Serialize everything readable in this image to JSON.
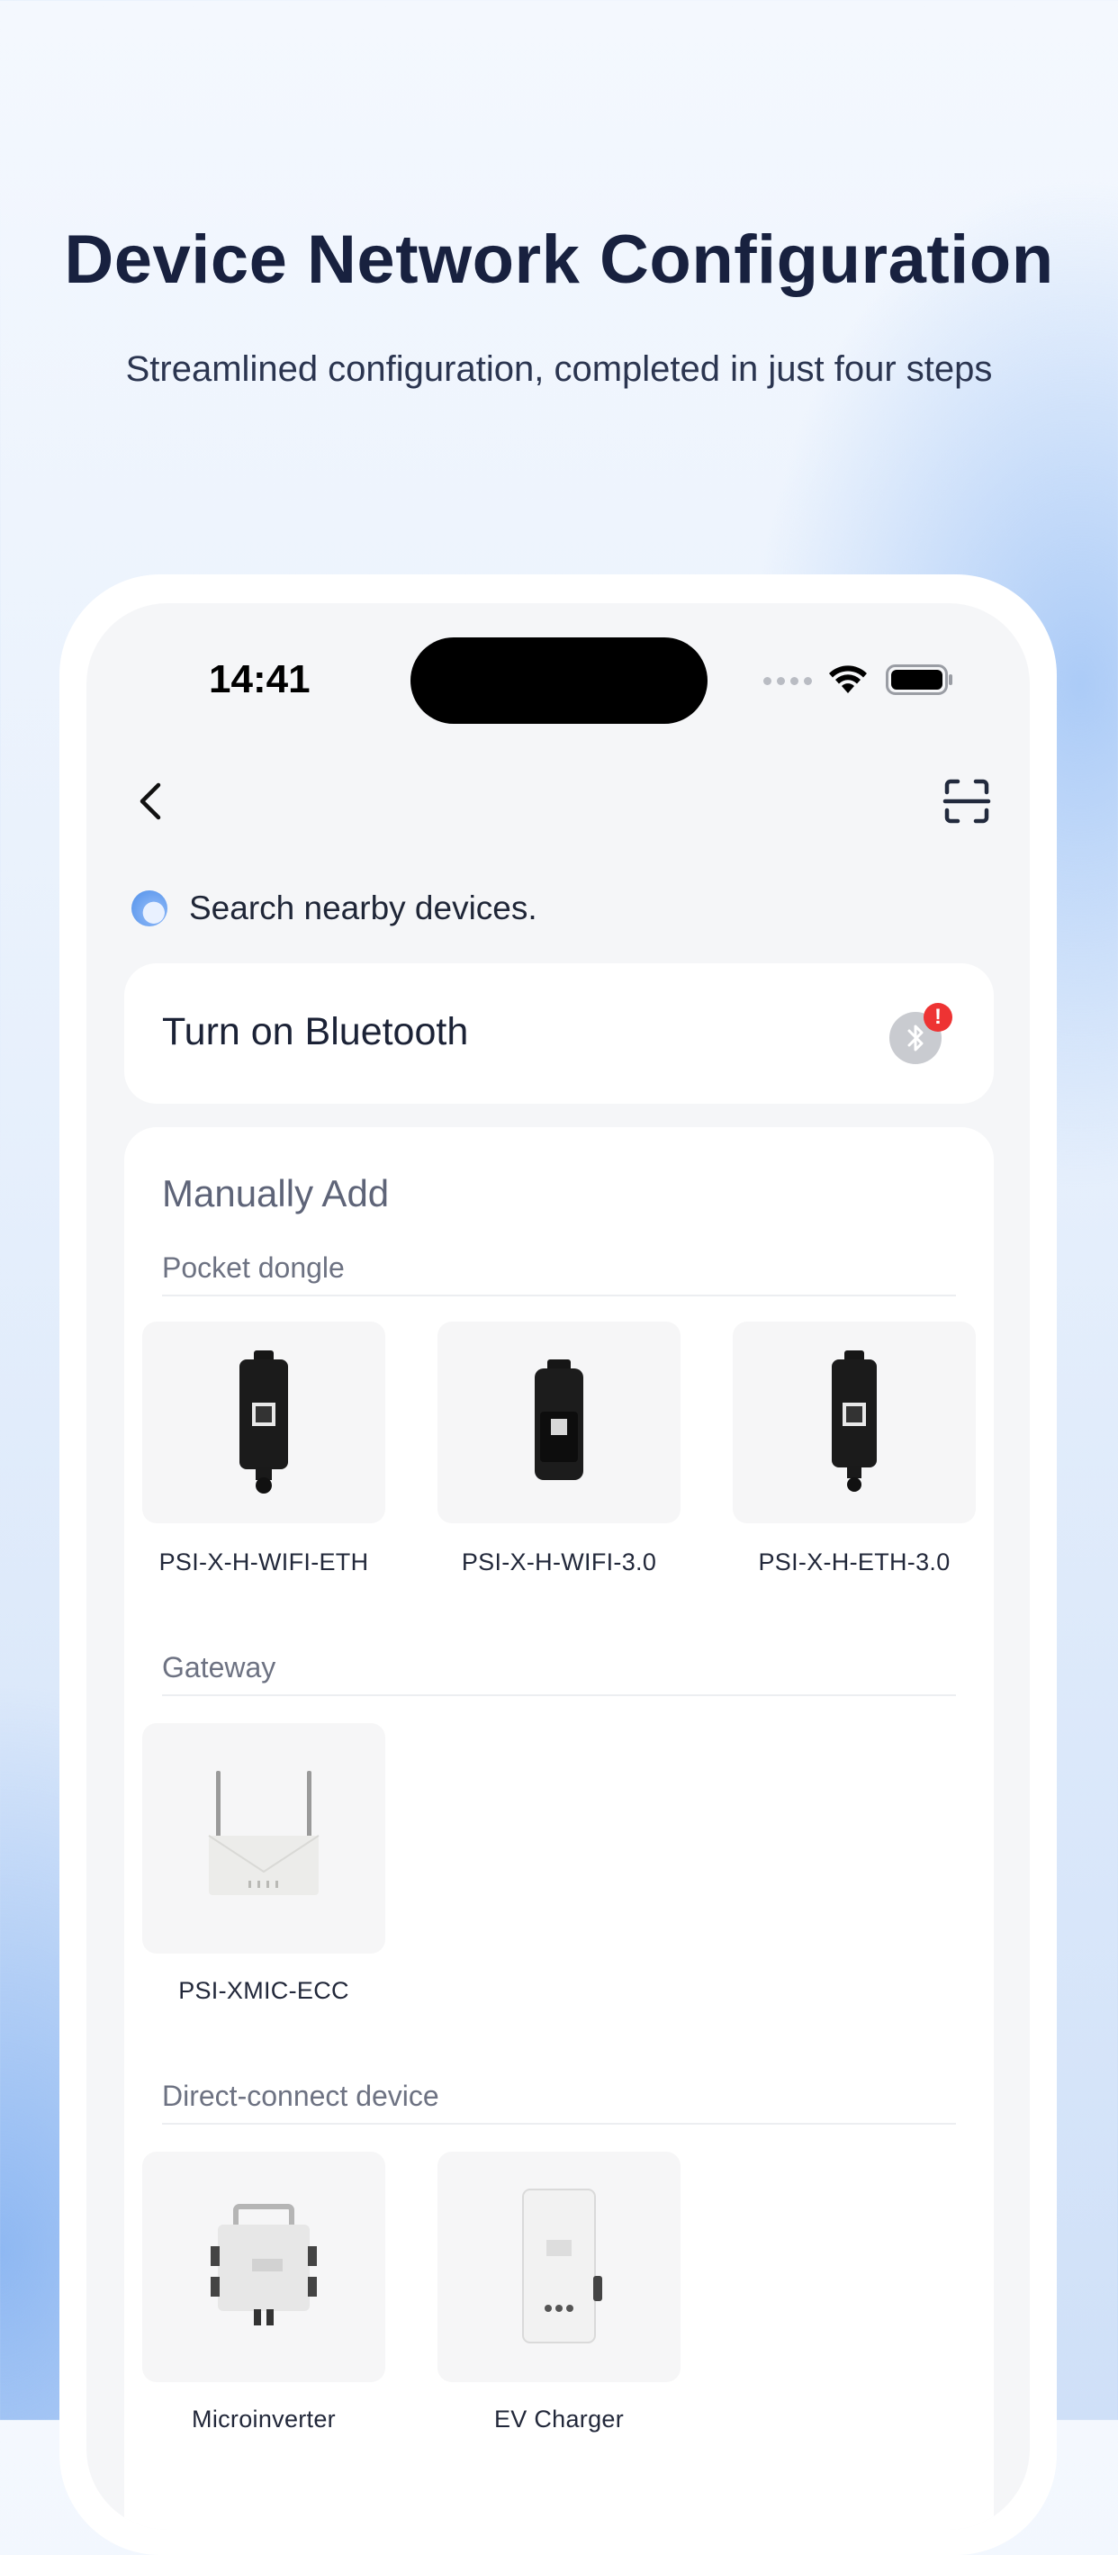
{
  "headline": "Device Network Configuration",
  "subline": "Streamlined configuration, completed in just four steps",
  "status_bar": {
    "time": "14:41"
  },
  "search": {
    "text": "Search nearby devices."
  },
  "bluetooth": {
    "label": "Turn on Bluetooth",
    "badge": "!"
  },
  "manual": {
    "title": "Manually Add",
    "pocket": {
      "label": "Pocket dongle",
      "items": [
        "PSI-X-H-WIFI-ETH",
        "PSI-X-H-WIFI-3.0",
        "PSI-X-H-ETH-3.0"
      ]
    },
    "gateway": {
      "label": "Gateway",
      "items": [
        "PSI-XMIC-ECC"
      ]
    },
    "direct": {
      "label": "Direct-connect device",
      "items": [
        "Microinverter",
        "EV Charger"
      ]
    }
  },
  "colors": {
    "heading": "#18213f",
    "badge": "#ee3333",
    "accent": "#4f8fe9"
  }
}
